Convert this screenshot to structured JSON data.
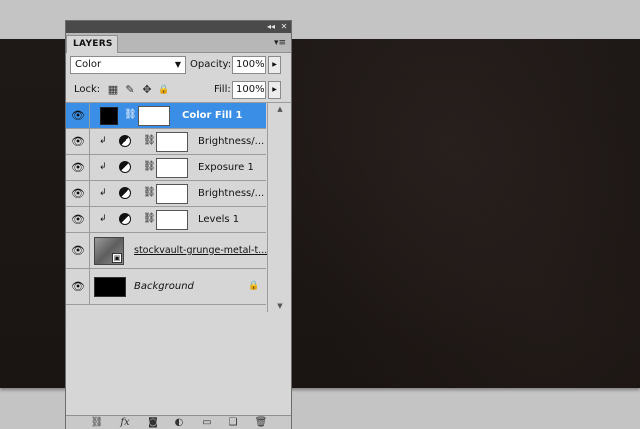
{
  "panel": {
    "titlebar": {
      "collapse_glyph": "◂◂",
      "close_glyph": "✕"
    },
    "tab_label": "LAYERS",
    "menu_glyph": "▾≡"
  },
  "options": {
    "blend_mode": "Color",
    "blend_arrow": "▼",
    "opacity_label": "Opacity:",
    "opacity_value": "100%",
    "fill_label": "Fill:",
    "fill_value": "100%",
    "step_glyph": "▶"
  },
  "lock": {
    "label": "Lock:",
    "icons": [
      {
        "name": "lock-transparent-icon",
        "glyph": "▦"
      },
      {
        "name": "lock-image-icon",
        "glyph": "✎"
      },
      {
        "name": "lock-position-icon",
        "glyph": "✥"
      },
      {
        "name": "lock-all-icon",
        "glyph": "🔒"
      }
    ]
  },
  "layers": [
    {
      "name": "Color Fill 1",
      "type": "fill",
      "selected": true,
      "clipped": false
    },
    {
      "name": "Brightness/...",
      "type": "adjustment",
      "selected": false,
      "clipped": true
    },
    {
      "name": "Exposure 1",
      "type": "adjustment",
      "selected": false,
      "clipped": true
    },
    {
      "name": "Brightness/...",
      "type": "adjustment",
      "selected": false,
      "clipped": true
    },
    {
      "name": "Levels 1",
      "type": "adjustment",
      "selected": false,
      "clipped": true
    },
    {
      "name": "stockvault-grunge-metal-t...",
      "type": "smart-object",
      "selected": false,
      "clipped": false
    },
    {
      "name": "Background",
      "type": "background",
      "selected": false,
      "clipped": false,
      "locked": true
    }
  ],
  "glyphs": {
    "eye": "👁",
    "chain": "⛓",
    "clip_arrow": "↲",
    "lock": "🔒",
    "scroll_up": "▲",
    "scroll_down": "▼"
  },
  "bottom_bar": [
    {
      "name": "link-layers-icon",
      "glyph": "⛓"
    },
    {
      "name": "layer-style-icon",
      "glyph": "fx"
    },
    {
      "name": "add-mask-icon",
      "glyph": "◙"
    },
    {
      "name": "new-adjustment-icon",
      "glyph": "◐"
    },
    {
      "name": "new-group-icon",
      "glyph": "▭"
    },
    {
      "name": "new-layer-icon",
      "glyph": "❏"
    },
    {
      "name": "delete-layer-icon",
      "glyph": "🗑"
    }
  ],
  "colors": {
    "canvas": "#1c1614",
    "selection": "#3a8ee6",
    "panel_bg": "#d6d6d6",
    "workspace": "#c4c4c4"
  }
}
